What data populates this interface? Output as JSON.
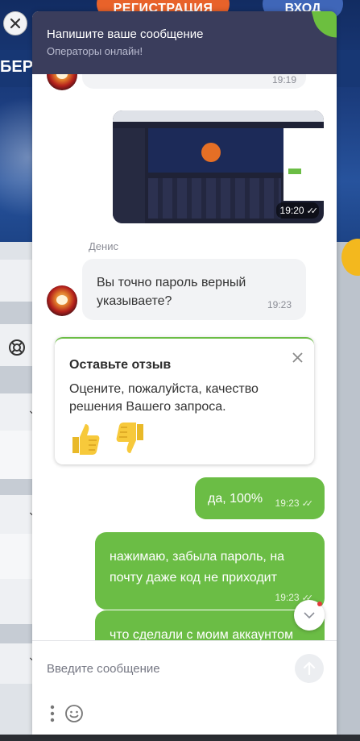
{
  "background": {
    "register_label": "РЕГИСТРАЦИЯ",
    "login_label": "ВХОД",
    "banner_text": "БЕРС"
  },
  "header": {
    "title": "Напишите ваше сообщение",
    "subtitle": "Операторы онлайн!"
  },
  "messages": {
    "first_time": "19:19",
    "attachment_time": "19:20",
    "sender_name": "Денис",
    "operator_text": "Вы точно пароль верный указываете?",
    "operator_time": "19:23",
    "user_1_text": "да, 100%",
    "user_1_time": "19:23",
    "user_2_text": "нажимаю, забыла пароль, на почту даже код не приходит",
    "user_2_time": "19:23",
    "user_3_text": "что сделали с моим аккаунтом"
  },
  "feedback": {
    "title": "Оставьте отзыв",
    "text": "Оцените, пожалуйста, качество решения Вашего запроса."
  },
  "input": {
    "placeholder": "Введите сообщение"
  },
  "colors": {
    "header_bg": "#3a3d5c",
    "outgoing_bubble": "#6bbd45",
    "incoming_bubble": "#f2f3f5"
  }
}
